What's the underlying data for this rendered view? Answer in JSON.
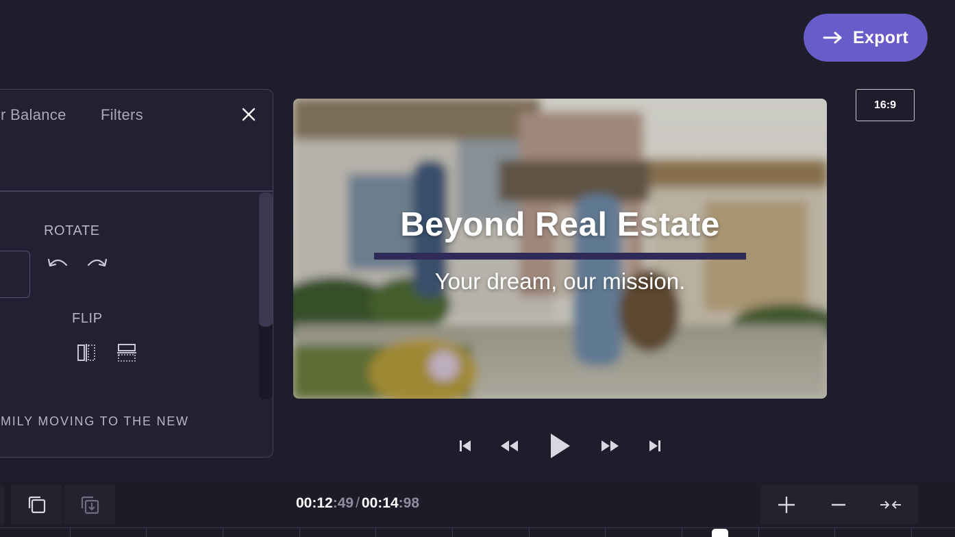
{
  "header": {
    "export_label": "Export",
    "export_icon": "arrow-right-icon",
    "aspect_ratio": "16:9"
  },
  "panel": {
    "tabs": [
      {
        "label": "r Balance"
      },
      {
        "label": "Filters"
      }
    ],
    "rotate_label": "ROTATE",
    "flip_label": "FLIP",
    "clip_name": "MILY MOVING TO THE NEW"
  },
  "preview": {
    "title": "Beyond Real Estate",
    "subtitle": "Your dream, our mission."
  },
  "timeline": {
    "current_main": "00:12",
    "current_frac": ":49",
    "separator": "/",
    "total_main": "00:14",
    "total_frac": ":98"
  },
  "colors": {
    "accent": "#6a5cc8",
    "background": "#1e1d2b",
    "title_bar": "#2f2a58"
  }
}
